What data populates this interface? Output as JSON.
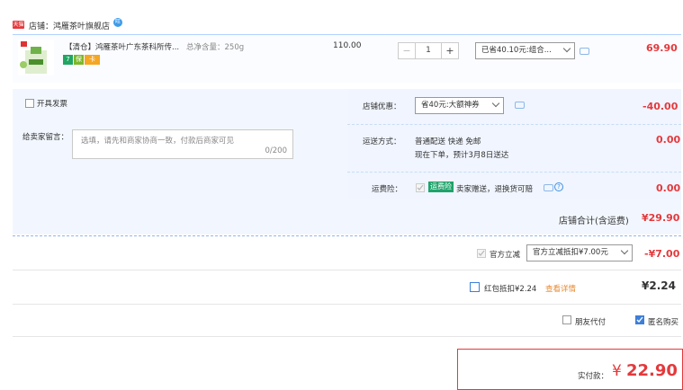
{
  "shop": {
    "badge": "天猫",
    "label": "店铺：鸿雁茶叶旗舰店",
    "ww": "旺"
  },
  "item": {
    "title": "【清仓】鸿雁茶叶广东茶科所传...",
    "spec": "总净含量：250g",
    "tags": [
      {
        "icon": "seven-day-icon",
        "text": "7",
        "color": "#20a662"
      },
      {
        "icon": "guarantee-icon",
        "text": "保",
        "color": "#7cb82a"
      },
      {
        "icon": "card-icon",
        "text": "卡",
        "color": "#f5a623"
      }
    ],
    "unit_price": "110.00",
    "quantity": "1",
    "minus": "−",
    "plus": "+",
    "discount_select": "已省40.10元:组合...",
    "subtotal": "69.90"
  },
  "invoice": {
    "label": "开具发票"
  },
  "message": {
    "label": "给卖家留言：",
    "placeholder": "选填，请先和商家协商一致，付款后商家可见",
    "count": "0/200"
  },
  "shop_coupon": {
    "label": "店铺优惠：",
    "select": "省40元:大额神券",
    "amount": "-40.00"
  },
  "shipping": {
    "label": "运送方式：",
    "method": "普通配送 快递 免邮",
    "note": "现在下单，预计3月8日送达",
    "amount": "0.00"
  },
  "insurance": {
    "label": "运费险：",
    "badge": "运费险",
    "text": "卖家赠送，退换货可赔",
    "help": "?",
    "amount": "0.00"
  },
  "shop_total": {
    "label": "店铺合计(含运费)",
    "value": "¥29.90"
  },
  "official": {
    "label": "官方立减",
    "select": "官方立减抵扣¥7.00元",
    "amount": "-¥7.00"
  },
  "redpack": {
    "label": "红包抵扣¥2.24",
    "link": "查看详情",
    "amount": "¥2.24"
  },
  "options": {
    "friend_pay": "朋友代付",
    "anonymous": "匿名购买"
  },
  "pay": {
    "label": "实付款：",
    "currency": "¥",
    "value": "22.90"
  },
  "colors": {
    "accent": "#e4393c",
    "border": "#b2d1ff"
  }
}
